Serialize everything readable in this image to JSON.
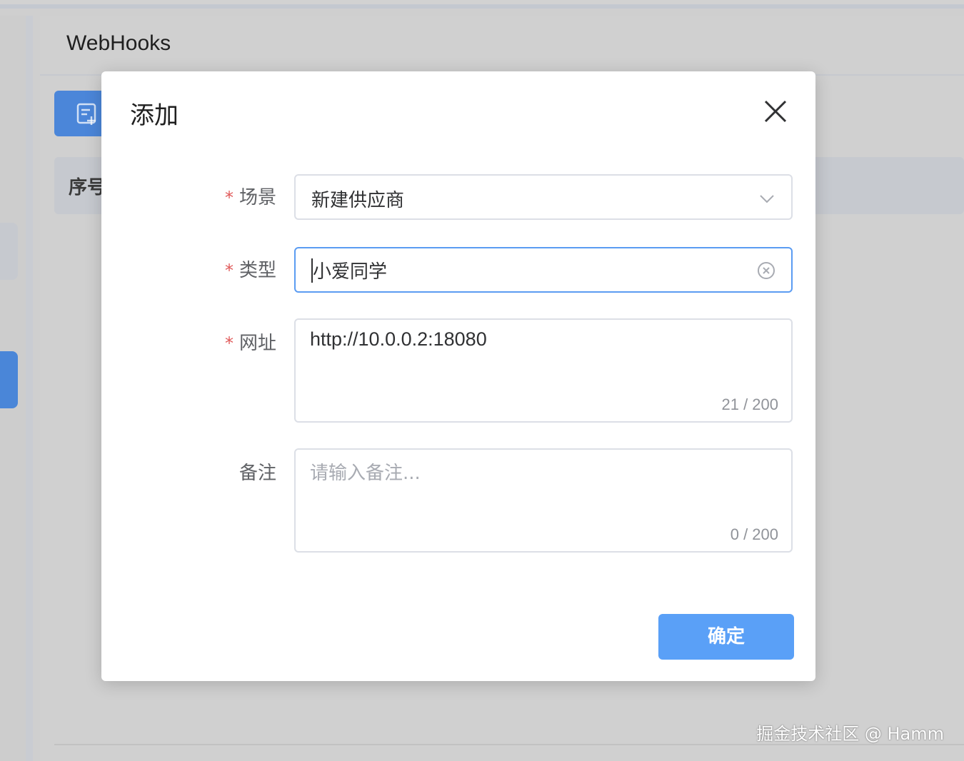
{
  "page": {
    "title": "WebHooks",
    "table_first_column": "序号"
  },
  "dialog": {
    "title": "添加",
    "fields": {
      "scene": {
        "label": "场景",
        "required": true,
        "value": "新建供应商"
      },
      "type": {
        "label": "类型",
        "required": true,
        "value": "小爱同学"
      },
      "url": {
        "label": "网址",
        "required": true,
        "value": "http://10.0.0.2:18080",
        "count": "21 / 200"
      },
      "note": {
        "label": "备注",
        "required": false,
        "placeholder": "请输入备注...",
        "count": "0 / 200"
      }
    },
    "required_mark": "*",
    "confirm_label": "确定"
  },
  "watermark": "掘金技术社区 @ Hamm",
  "icons": {
    "add_button": "add-note-icon",
    "close": "close-icon",
    "select": "chevron-down-icon",
    "clear": "clear-circle-icon"
  },
  "colors": {
    "primary": "#5aa0f7",
    "focus_border": "#5b9cf2",
    "required": "#e05a5a"
  }
}
